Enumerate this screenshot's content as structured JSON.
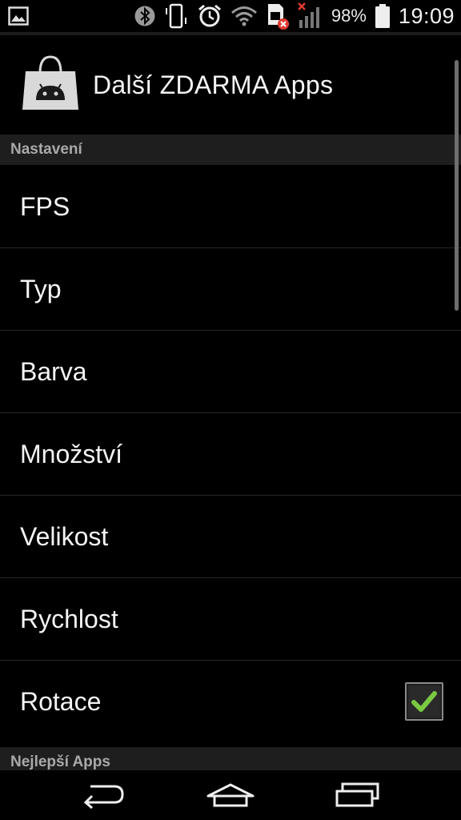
{
  "status_bar": {
    "battery_percent": "98%",
    "battery_level": 0.98,
    "time": "19:09",
    "icons": [
      "image-notification-icon",
      "bluetooth-icon",
      "vibrate-icon",
      "alarm-icon",
      "wifi-icon",
      "sim-error-icon",
      "signal-no-service-icon",
      "battery-icon"
    ]
  },
  "header": {
    "title": "Další ZDARMA Apps",
    "icon": "android-store-bag-icon"
  },
  "sections": {
    "settings_title": "Nastavení",
    "more_title": "Nejlepší Apps"
  },
  "preferences": [
    {
      "label": "FPS"
    },
    {
      "label": "Typ"
    },
    {
      "label": "Barva"
    },
    {
      "label": "Množství"
    },
    {
      "label": "Velikost"
    },
    {
      "label": "Rychlost"
    },
    {
      "label": "Rotace",
      "checked": true
    }
  ],
  "navigation": [
    "back-icon",
    "home-icon",
    "recent-apps-icon"
  ],
  "colors": {
    "background": "#000000",
    "section_bg": "#1e1e1e",
    "check_green": "#7ac943"
  }
}
